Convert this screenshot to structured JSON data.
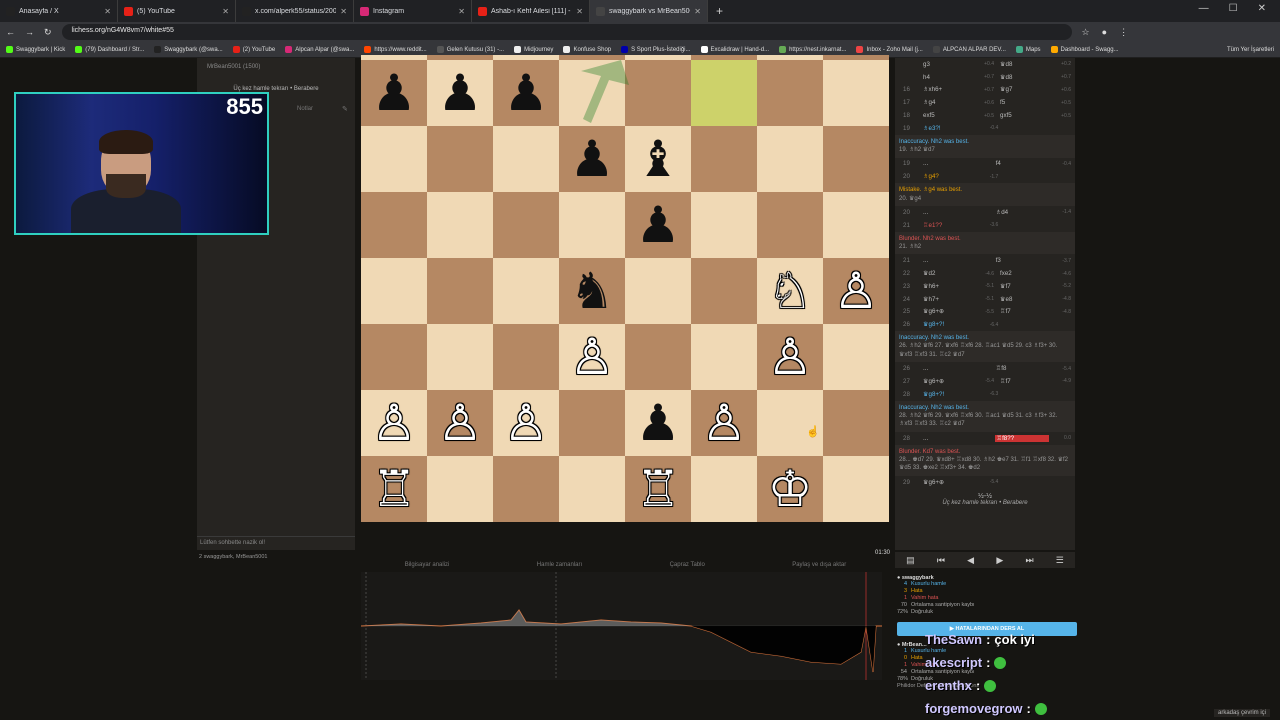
{
  "tabs": [
    {
      "label": "Anasayfa / X",
      "color": "#222"
    },
    {
      "label": "(5) YouTube",
      "color": "#e62117"
    },
    {
      "label": "x.com/alperk55/status/200989...",
      "color": "#222"
    },
    {
      "label": "Instagram",
      "color": "#d62976"
    },
    {
      "label": "Ashab-ı Kehf Ailesi [111] - bayr",
      "color": "#e62117"
    },
    {
      "label": "swaggybark vs MrBean500...",
      "color": "#444"
    }
  ],
  "url": "lichess.org/nG4W8vm7/white#55",
  "bookmarks": [
    "Swaggybark | Kick",
    "(79) Dashboard / Str...",
    "Swaggybark (@swa...",
    "(2) YouTube",
    "Alpcan Alpar (@swa...",
    "https://www.reddit...",
    "Gelen Kutusu (31) -...",
    "Midjourney",
    "Konfuse Shop",
    "S Sport Plus-İstediği...",
    "Excalidraw | Hand-d...",
    "https://nest.inkarnat...",
    "Inbox - Zoho Mail (j...",
    "ALPCAN ALPAR DEV...",
    "Maps",
    "Dashboard - Swagg..."
  ],
  "bookmarks_all": "Tüm Yer İşaretleri",
  "left": {
    "player": "MrBean5001 (1500)",
    "status": "Üç kez hamle tekrarı • Berabere",
    "notes": "Notlar",
    "chat_placeholder": "Lütfen sohbette nazik ol!",
    "spectators": "2 swaggybark, MrBean5001"
  },
  "webcam": {
    "count": "855"
  },
  "board": {
    "pieces": [
      {
        "sq": "a8",
        "p": "♜",
        "c": "w"
      },
      {
        "sq": "d8",
        "p": "♛",
        "c": "w"
      },
      {
        "sq": "e8",
        "p": "♚",
        "c": "w"
      },
      {
        "sq": "f8",
        "p": "♜",
        "c": "b"
      },
      {
        "sq": "g8",
        "p": "♛",
        "c": "w"
      },
      {
        "sq": "a7",
        "p": "♟",
        "c": "b"
      },
      {
        "sq": "b7",
        "p": "♟",
        "c": "b"
      },
      {
        "sq": "c7",
        "p": "♟",
        "c": "b"
      },
      {
        "sq": "d6",
        "p": "♟",
        "c": "b"
      },
      {
        "sq": "e6",
        "p": "♝",
        "c": "b"
      },
      {
        "sq": "e5",
        "p": "♟",
        "c": "b"
      },
      {
        "sq": "d4",
        "p": "♞",
        "c": "b"
      },
      {
        "sq": "g4",
        "p": "♘",
        "c": "w"
      },
      {
        "sq": "h4",
        "p": "♙",
        "c": "w"
      },
      {
        "sq": "d3",
        "p": "♙",
        "c": "w"
      },
      {
        "sq": "g3",
        "p": "♙",
        "c": "w"
      },
      {
        "sq": "a2",
        "p": "♙",
        "c": "w"
      },
      {
        "sq": "b2",
        "p": "♙",
        "c": "w"
      },
      {
        "sq": "c2",
        "p": "♙",
        "c": "w"
      },
      {
        "sq": "e2",
        "p": "♟",
        "c": "b"
      },
      {
        "sq": "f2",
        "p": "♙",
        "c": "w"
      },
      {
        "sq": "a1",
        "p": "♖",
        "c": "w"
      },
      {
        "sq": "e1",
        "p": "♖",
        "c": "w"
      },
      {
        "sq": "g1",
        "p": "♔",
        "c": "w"
      }
    ],
    "highlight": [
      "f8",
      "f7"
    ],
    "clock": "01:30"
  },
  "moves": [
    {
      "n": "",
      "w": "g3",
      "we": "+0.4",
      "b": "♛d8",
      "be": "+0.2"
    },
    {
      "n": "",
      "w": "h4",
      "we": "+0.7",
      "b": "♛d8",
      "be": "+0.7"
    },
    {
      "n": "16",
      "w": "♗xh6+",
      "we": "+0.7",
      "b": "♛g7",
      "be": "+0.6"
    },
    {
      "n": "17",
      "w": "♗g4",
      "we": "+0.6",
      "b": "f5",
      "be": "+0.5"
    },
    {
      "n": "18",
      "w": "exf5",
      "we": "+0.5",
      "b": "gxf5",
      "be": "+0.5"
    },
    {
      "n": "19",
      "w": "♗e3?!",
      "we": "-0.4",
      "b": "",
      "be": ""
    }
  ],
  "comments": [
    {
      "type": "t1",
      "text": "Inaccuracy. Nh2 was best.",
      "line": "19. ♗h2 ♛d7"
    },
    {
      "type": "row",
      "n": "19",
      "w": "...",
      "b": "f4",
      "be": "-0.4"
    },
    {
      "type": "row",
      "n": "20",
      "w": "♗g4?",
      "we": "-1.7",
      "b": "",
      "be": ""
    },
    {
      "type": "t2",
      "text": "Mistake. ♗g4 was best.",
      "line": "20. ♛g4"
    },
    {
      "type": "row",
      "n": "20",
      "w": "...",
      "b": "♗d4",
      "be": "-1.4"
    },
    {
      "type": "row",
      "n": "21",
      "w": "♖e1??",
      "we": "-3.6",
      "b": "",
      "be": ""
    },
    {
      "type": "t3",
      "text": "Blunder. Nh2 was best.",
      "line": "21. ♗h2"
    },
    {
      "type": "row",
      "n": "21",
      "w": "...",
      "b": "f3",
      "be": "-3.7"
    },
    {
      "type": "row",
      "n": "22",
      "w": "♛d2",
      "we": "-4.6",
      "b": "fxe2",
      "be": "-4.6"
    },
    {
      "type": "row",
      "n": "23",
      "w": "♛h6+",
      "we": "-5.1",
      "b": "♛f7",
      "be": "-5.2"
    },
    {
      "type": "row",
      "n": "24",
      "w": "♛h7+",
      "we": "-5.1",
      "b": "♛e8",
      "be": "-4.8"
    },
    {
      "type": "row",
      "n": "25",
      "w": "♛g6+⊕",
      "we": "-5.5",
      "b": "♖f7",
      "be": "-4.8"
    },
    {
      "type": "row",
      "n": "26",
      "w": "♛g8+?!",
      "we": "-6.4",
      "b": "",
      "be": ""
    },
    {
      "type": "t1",
      "text": "Inaccuracy. Nh2 was best.",
      "line": "26. ♗h2 ♛f6 27. ♛xf6 ♖xf6 28. ♖ac1 ♛d5 29. c3 ♗f3+ 30. ♛xf3 ♖xf3 31. ♖c2 ♛d7"
    },
    {
      "type": "row",
      "n": "26",
      "w": "...",
      "b": "♖f8",
      "be": "-5.4"
    },
    {
      "type": "row",
      "n": "27",
      "w": "♛g6+⊕",
      "we": "-5.4",
      "b": "♖f7",
      "be": "-4.9"
    },
    {
      "type": "row",
      "n": "28",
      "w": "♛g8+?!",
      "we": "-6.3",
      "b": "",
      "be": ""
    },
    {
      "type": "t1",
      "text": "Inaccuracy. Nh2 was best.",
      "line": "28. ♗h2 ♛f6 29. ♛xf6 ♖xf6 30. ♖ac1 ♛d5 31. c3 ♗f3+ 32. ♗xf3 ♖xf3 33. ♖c2 ♛d7"
    },
    {
      "type": "row",
      "n": "28",
      "w": "...",
      "b": "♖f8??",
      "be": "0.0",
      "blunder": true
    },
    {
      "type": "t3",
      "text": "Blunder. Kd7 was best.",
      "line": "28... ♚d7 29. ♛xd8+ ♖xd8 30. ♗h2 ♚e7 31. ♖f1 ♖xf8 32. ♛f2 ♛d5 33. ♚xe2 ♖xf3+ 34. ♚d2"
    },
    {
      "type": "row",
      "n": "29",
      "w": "♛g6+⊕",
      "we": "-5.4",
      "b": "",
      "be": ""
    }
  ],
  "result": "½-½",
  "result_text": "Üç kez hamle tekrarı • Berabere",
  "analysis_tabs": [
    "Bilgisayar analizi",
    "Hamle zamanları",
    "Çapraz Tablo",
    "Paylaş ve dışa aktar"
  ],
  "summary_white": {
    "name": "swaggybark",
    "rows": [
      [
        "4",
        "Kusurlu hamle",
        "c-blue"
      ],
      [
        "3",
        "Hata",
        "c-orange"
      ],
      [
        "1",
        "Vahim hata",
        "c-red"
      ],
      [
        "70",
        "Ortalama santipiyon kaybı",
        ""
      ],
      [
        "72%",
        "Doğruluk",
        ""
      ]
    ]
  },
  "learn_btn": "HATALARINDAN DERS AL",
  "summary_black": {
    "name": "MrBean...",
    "rows": [
      [
        "1",
        "Kusurlu hamle",
        "c-blue"
      ],
      [
        "0",
        "Hata",
        "c-orange"
      ],
      [
        "1",
        "Vahim hata",
        "c-red"
      ],
      [
        "54",
        "Ortalama santipiyon kaybı",
        ""
      ],
      [
        "78%",
        "Doğruluk",
        ""
      ]
    ]
  },
  "opening": "Philidor Defense: Other variations",
  "chat": [
    {
      "user": "TheSawn",
      "msg": "çok iyi",
      "emo": false
    },
    {
      "user": "akescript",
      "msg": "",
      "emo": true
    },
    {
      "user": "erenthx",
      "msg": "",
      "emo": true
    },
    {
      "user": "forgemovegrow",
      "msg": "",
      "emo": true
    }
  ],
  "bottom_right": "arkadaş çevrim içi"
}
